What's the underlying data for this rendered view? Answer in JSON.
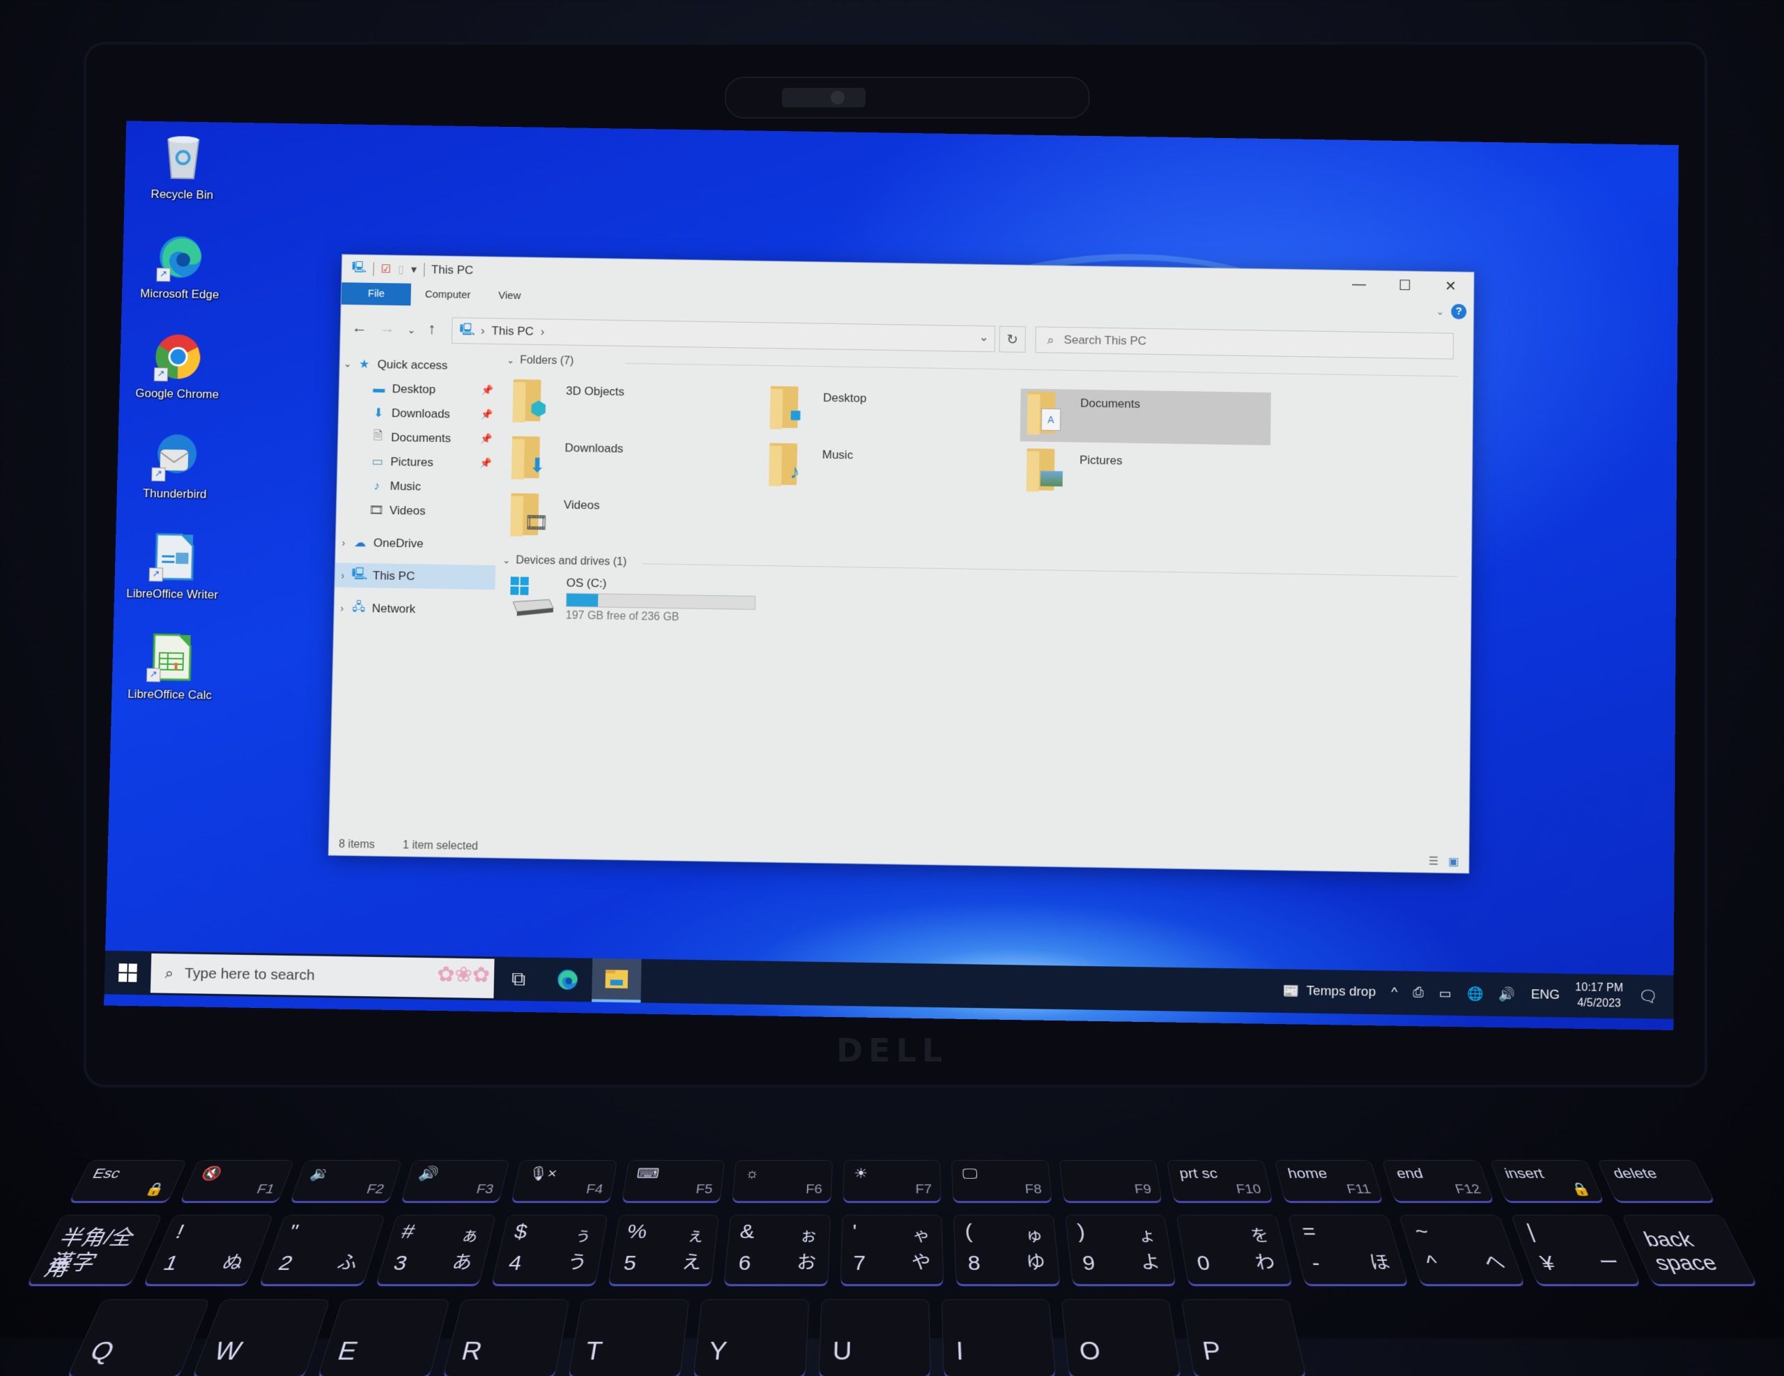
{
  "desktop": {
    "icons": [
      {
        "label": "Recycle Bin",
        "icon": "recycle-bin-icon",
        "shortcut": false
      },
      {
        "label": "Microsoft Edge",
        "icon": "edge-icon",
        "shortcut": true
      },
      {
        "label": "Google Chrome",
        "icon": "chrome-icon",
        "shortcut": true
      },
      {
        "label": "Thunderbird",
        "icon": "thunderbird-icon",
        "shortcut": true
      },
      {
        "label": "LibreOffice Writer",
        "icon": "libreoffice-writer-icon",
        "shortcut": true
      },
      {
        "label": "LibreOffice Calc",
        "icon": "libreoffice-calc-icon",
        "shortcut": true
      }
    ]
  },
  "explorer": {
    "title": "This PC",
    "ribbon_tabs": [
      "File",
      "Computer",
      "View"
    ],
    "window_controls": {
      "minimize": "—",
      "maximize": "☐",
      "close": "✕"
    },
    "address": {
      "segments": [
        "This PC"
      ],
      "separator": "›"
    },
    "search_placeholder": "Search This PC",
    "help_label": "?",
    "nav_pane": {
      "quick_access": {
        "label": "Quick access",
        "items": [
          {
            "label": "Desktop",
            "pinned": true
          },
          {
            "label": "Downloads",
            "pinned": true
          },
          {
            "label": "Documents",
            "pinned": true
          },
          {
            "label": "Pictures",
            "pinned": true
          },
          {
            "label": "Music",
            "pinned": false
          },
          {
            "label": "Videos",
            "pinned": false
          }
        ]
      },
      "roots": [
        {
          "label": "OneDrive",
          "selected": false
        },
        {
          "label": "This PC",
          "selected": true
        },
        {
          "label": "Network",
          "selected": false
        }
      ]
    },
    "folders_header": "Folders (7)",
    "folders": [
      {
        "name": "3D Objects",
        "selected": false
      },
      {
        "name": "Desktop",
        "selected": false
      },
      {
        "name": "Documents",
        "selected": true
      },
      {
        "name": "Downloads",
        "selected": false
      },
      {
        "name": "Music",
        "selected": false
      },
      {
        "name": "Pictures",
        "selected": false
      },
      {
        "name": "Videos",
        "selected": false
      }
    ],
    "drives_header": "Devices and drives (1)",
    "drives": [
      {
        "name": "OS (C:)",
        "free_text": "197 GB free of 236 GB",
        "used_fraction": 0.165
      }
    ],
    "status": {
      "item_count": "8 items",
      "selection": "1 item selected"
    }
  },
  "taskbar": {
    "search_placeholder": "Type here to search",
    "apps": [
      {
        "name": "Task View",
        "active": false
      },
      {
        "name": "Microsoft Edge",
        "active": false
      },
      {
        "name": "File Explorer",
        "active": true
      }
    ],
    "news_widget": "Temps drop",
    "language": "ENG",
    "time": "10:17 PM",
    "date": "4/5/2023"
  },
  "hardware": {
    "brand": "DELL",
    "function_keys": [
      {
        "label": "Esc",
        "sub": "🔒"
      },
      {
        "label": "🔇",
        "sub": "F1"
      },
      {
        "label": "🔉",
        "sub": "F2"
      },
      {
        "label": "🔊",
        "sub": "F3"
      },
      {
        "label": "🎙×",
        "sub": "F4"
      },
      {
        "label": "⌨",
        "sub": "F5"
      },
      {
        "label": "☼",
        "sub": "F6"
      },
      {
        "label": "☀",
        "sub": "F7"
      },
      {
        "label": "🖵",
        "sub": "F8"
      },
      {
        "label": "",
        "sub": "F9"
      },
      {
        "label": "prt sc",
        "sub": "F10"
      },
      {
        "label": "home",
        "sub": "F11"
      },
      {
        "label": "end",
        "sub": "F12"
      },
      {
        "label": "insert",
        "sub": "🔒"
      },
      {
        "label": "delete",
        "sub": ""
      }
    ],
    "number_keys": [
      {
        "top": "半角/全角",
        "main": "漢字",
        "kana_top": "",
        "kana": ""
      },
      {
        "top": "!",
        "main": "1",
        "kana_top": "",
        "kana": "ぬ"
      },
      {
        "top": "\"",
        "main": "2",
        "kana_top": "",
        "kana": "ふ"
      },
      {
        "top": "#",
        "main": "3",
        "kana_top": "ぁ",
        "kana": "あ"
      },
      {
        "top": "$",
        "main": "4",
        "kana_top": "ぅ",
        "kana": "う"
      },
      {
        "top": "%",
        "main": "5",
        "kana_top": "ぇ",
        "kana": "え"
      },
      {
        "top": "&",
        "main": "6",
        "kana_top": "ぉ",
        "kana": "お"
      },
      {
        "top": "'",
        "main": "7",
        "kana_top": "ゃ",
        "kana": "や"
      },
      {
        "top": "(",
        "main": "8",
        "kana_top": "ゅ",
        "kana": "ゆ"
      },
      {
        "top": ")",
        "main": "9",
        "kana_top": "ょ",
        "kana": "よ"
      },
      {
        "top": "",
        "main": "0",
        "kana_top": "を",
        "kana": "わ"
      },
      {
        "top": "=",
        "main": "-",
        "kana_top": "",
        "kana": "ほ"
      },
      {
        "top": "~",
        "main": "^",
        "kana_top": "",
        "kana": "へ"
      },
      {
        "top": "|",
        "main": "¥",
        "kana_top": "",
        "kana": "ー"
      },
      {
        "top": "",
        "main": "back space",
        "kana_top": "",
        "kana": ""
      }
    ],
    "letter_keys": [
      "Q",
      "W",
      "E",
      "R",
      "T",
      "Y",
      "U",
      "I",
      "O",
      "P"
    ]
  }
}
